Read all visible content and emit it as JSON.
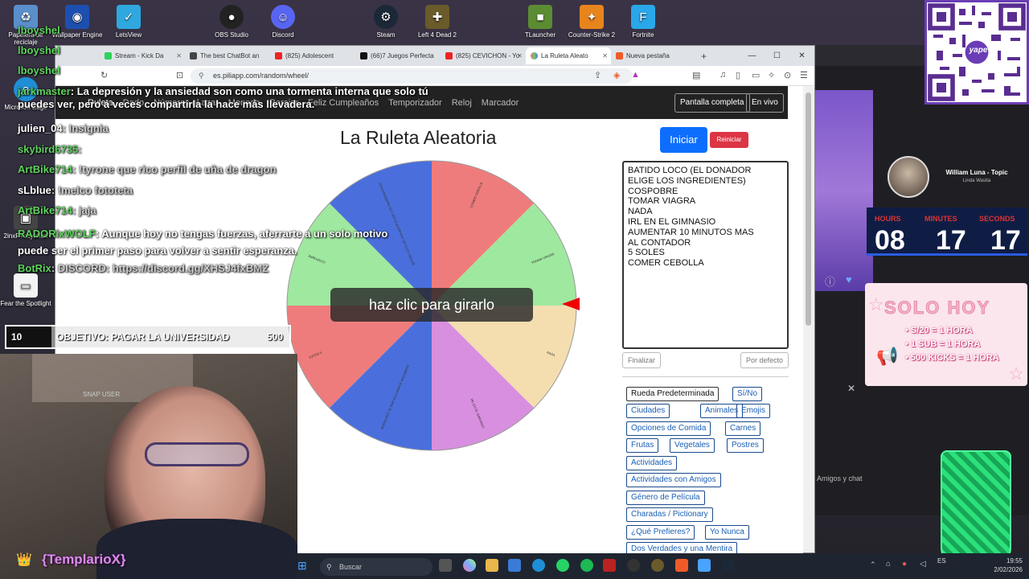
{
  "desktop_icons": [
    {
      "label": "Papelera de reciclaje"
    },
    {
      "label": "Wallpaper Engine"
    },
    {
      "label": "LetsView"
    },
    {
      "label": "OBS Studio"
    },
    {
      "label": "Discord"
    },
    {
      "label": "Steam"
    },
    {
      "label": "Left 4 Dead 2"
    },
    {
      "label": "TLauncher"
    },
    {
      "label": "Counter-Strike 2"
    },
    {
      "label": "Fortnite"
    },
    {
      "label": "Microsoft Edge"
    },
    {
      "label": "2inxP+coyhhon"
    },
    {
      "label": "Fear the Spotlight"
    }
  ],
  "browser": {
    "tabs": [
      {
        "label": "Stream - Kick Da"
      },
      {
        "label": "The best ChatBot an"
      },
      {
        "label": "(825) Adolescent"
      },
      {
        "label": "(66)7 Juegos Perfecta"
      },
      {
        "label": "(825) CEVICHON - Yo"
      },
      {
        "label": "La Ruleta Aleato"
      },
      {
        "label": "Nueva pestaña"
      }
    ],
    "new_tab": "+",
    "url": "es.piliapp.com/random/wheel/"
  },
  "site": {
    "nav": [
      "Ruleta",
      "Dado",
      "Números al azar",
      "Moneda",
      "Barajar",
      "Feliz Cumpleaños",
      "Temporizador",
      "Reloj",
      "Marcador"
    ],
    "fullscreen_label": "Pantalla completa",
    "live_label": "En vivo",
    "title": "La Ruleta Aleatoria",
    "start_label": "Iniciar",
    "reset_label": "Reiniciar",
    "spin_hint": "haz clic para girarlo",
    "options_text": "BATIDO LOCO (EL DONADOR\nELIGE LOS INGREDIENTES)\nCOSPOBRE\nTOMAR VIAGRA\nNADA\nIRL EN EL GIMNASIO\nAUMENTAR 10 MINUTOS MAS\nAL CONTADOR\n5 SOLES\nCOMER CEBOLLA",
    "finish_label": "Finalizar",
    "default_label": "Por defecto",
    "presets": [
      "Rueda Predeterminada",
      "Sí/No",
      "Ciudades",
      "Animales",
      "Emojis",
      "Opciones de Comida",
      "Carnes",
      "Frutas",
      "Vegetales",
      "Postres",
      "Actividades",
      "Actividades con Amigos",
      "Género de Película",
      "Charadas / Pictionary",
      "¿Qué Prefieres?",
      "Yo Nunca",
      "Dos Verdades y una Mentira"
    ],
    "wheel_segments": [
      {
        "label": "COMER CEBOLLA",
        "color": "#ef7c7c"
      },
      {
        "label": "TOMAR VIAGRA",
        "color": "#9fe89f"
      },
      {
        "label": "NADA",
        "color": "#f4deb0"
      },
      {
        "label": "IRL EN EL GIMNASIO",
        "color": "#d98fdf"
      },
      {
        "label": "AUMENTAR 10 MINUTOS MAS AL CONTADOR",
        "color": "#4a6fdc"
      },
      {
        "label": "5 SOLES",
        "color": "#ef7c7c"
      },
      {
        "label": "COSPOBRE",
        "color": "#9fe89f"
      },
      {
        "label": "BATIDO LOCO (EL DONADOR ELIGE LOS INGREDIENTES)",
        "color": "#4a6fdc"
      }
    ]
  },
  "chat": [
    {
      "user": "lboyshel",
      "msg": ""
    },
    {
      "user": "lboyshel",
      "msg": ""
    },
    {
      "user": "lboyshel",
      "msg": ""
    },
    {
      "user": "jarkmaster",
      "msg": ": La depresión y la ansiedad son como una tormenta interna que solo tú puedes ver, pero a veces compartirla la hace más llevadera."
    },
    {
      "user": "julien_04",
      "msg": ": Insignia"
    },
    {
      "user": "skybird6735",
      "msg": ":"
    },
    {
      "user": "ArtBike714",
      "msg": ": !tyrone que rico perfil de uña de dragon"
    },
    {
      "user": "sLblue",
      "msg": ": !melco fototeta"
    },
    {
      "user": "ArtBike714",
      "msg": ": jaja"
    },
    {
      "user": "RADORixWOLF",
      "msg": ": Aunque hoy no tengas fuerzas, aferrarte a un solo motivo puede ser el primer paso para volver a sentir esperanza."
    },
    {
      "user": "BotRix",
      "msg": ": DISCORD: https://discord.gg/XHSJ4fxBMZ"
    }
  ],
  "goal": {
    "count": "10",
    "label": "OBJETIVO: PAGAR LA UNIVERSIDAD",
    "target": "500"
  },
  "webcam_label": "SNAP USER",
  "streamer_tag": "{TemplarioX}",
  "song": {
    "title": "William Luna - Topic",
    "subtitle": "Linda Wasita"
  },
  "timer": {
    "hours_label": "HOURS",
    "minutes_label": "MINUTES",
    "seconds_label": "SECONDS",
    "hours": "08",
    "minutes": "17",
    "seconds": "17"
  },
  "promo": {
    "title": "SOLO HOY",
    "lines": [
      "S/20 = 1 HORA",
      "1 SUB = 1 HORA",
      "500 KICKS = 1 HORA"
    ]
  },
  "qr_brand": "yape",
  "side_panel": {
    "chat_hint": "Amigos y chat"
  },
  "taskbar": {
    "search_placeholder": "Buscar",
    "time": "19:55",
    "date": "2/02/2026",
    "lang": "ES"
  }
}
